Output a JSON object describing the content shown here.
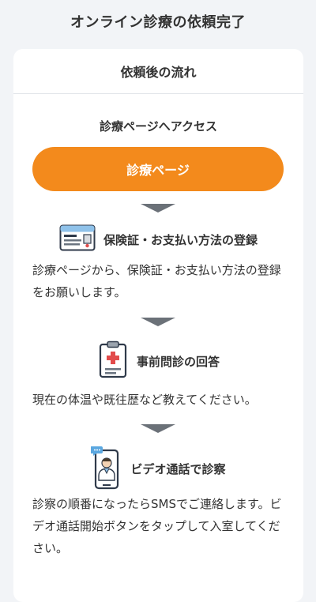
{
  "page": {
    "title": "オンライン診療の依頼完了"
  },
  "card": {
    "header": "依頼後の流れ",
    "access_title": "診療ページへアクセス",
    "button_label": "診療ページ",
    "steps": [
      {
        "icon": "insurance-card-icon",
        "title": "保険証・お支払い方法の登録",
        "description": "診療ページから、保険証・お支払い方法の登録をお願いします。"
      },
      {
        "icon": "clipboard-medical-icon",
        "title": "事前問診の回答",
        "description": "現在の体温や既往歴など教えてください。"
      },
      {
        "icon": "video-call-doctor-icon",
        "title": "ビデオ通話で診察",
        "description": "診察の順番になったらSMSでご連絡します。ビデオ通話開始ボタンをタップして入室してください。"
      }
    ]
  },
  "colors": {
    "accent": "#f38a1c",
    "arrow": "#6b7178",
    "background": "#f2f4f7",
    "card": "#ffffff"
  }
}
